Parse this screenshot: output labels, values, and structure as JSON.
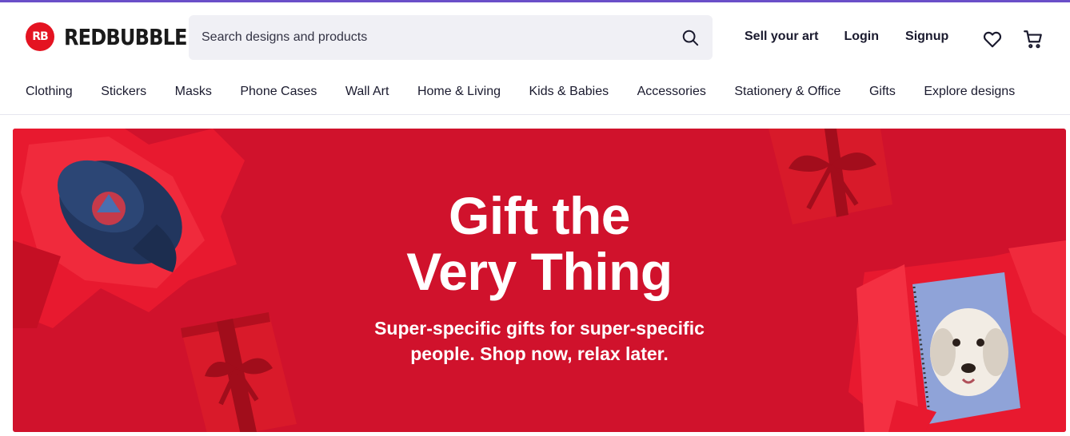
{
  "brand": {
    "logo_mark": "RB",
    "name": "REDBUBBLE",
    "accent": "#e41321",
    "topbar_color": "#6a4fc8"
  },
  "search": {
    "placeholder": "Search designs and products",
    "icon": "search-icon"
  },
  "header": {
    "sell_label": "Sell your art",
    "login_label": "Login",
    "signup_label": "Signup",
    "wishlist_icon": "heart-icon",
    "cart_icon": "cart-icon"
  },
  "nav": {
    "items": [
      {
        "label": "Clothing"
      },
      {
        "label": "Stickers"
      },
      {
        "label": "Masks"
      },
      {
        "label": "Phone Cases"
      },
      {
        "label": "Wall Art"
      },
      {
        "label": "Home & Living"
      },
      {
        "label": "Kids & Babies"
      },
      {
        "label": "Accessories"
      },
      {
        "label": "Stationery & Office"
      },
      {
        "label": "Gifts"
      },
      {
        "label": "Explore designs"
      }
    ]
  },
  "hero": {
    "title_line1": "Gift the",
    "title_line2": "Very Thing",
    "subtitle_line1": "Super-specific gifts for super-specific",
    "subtitle_line2": "people. Shop now, relax later.",
    "background": "#d0122c"
  }
}
